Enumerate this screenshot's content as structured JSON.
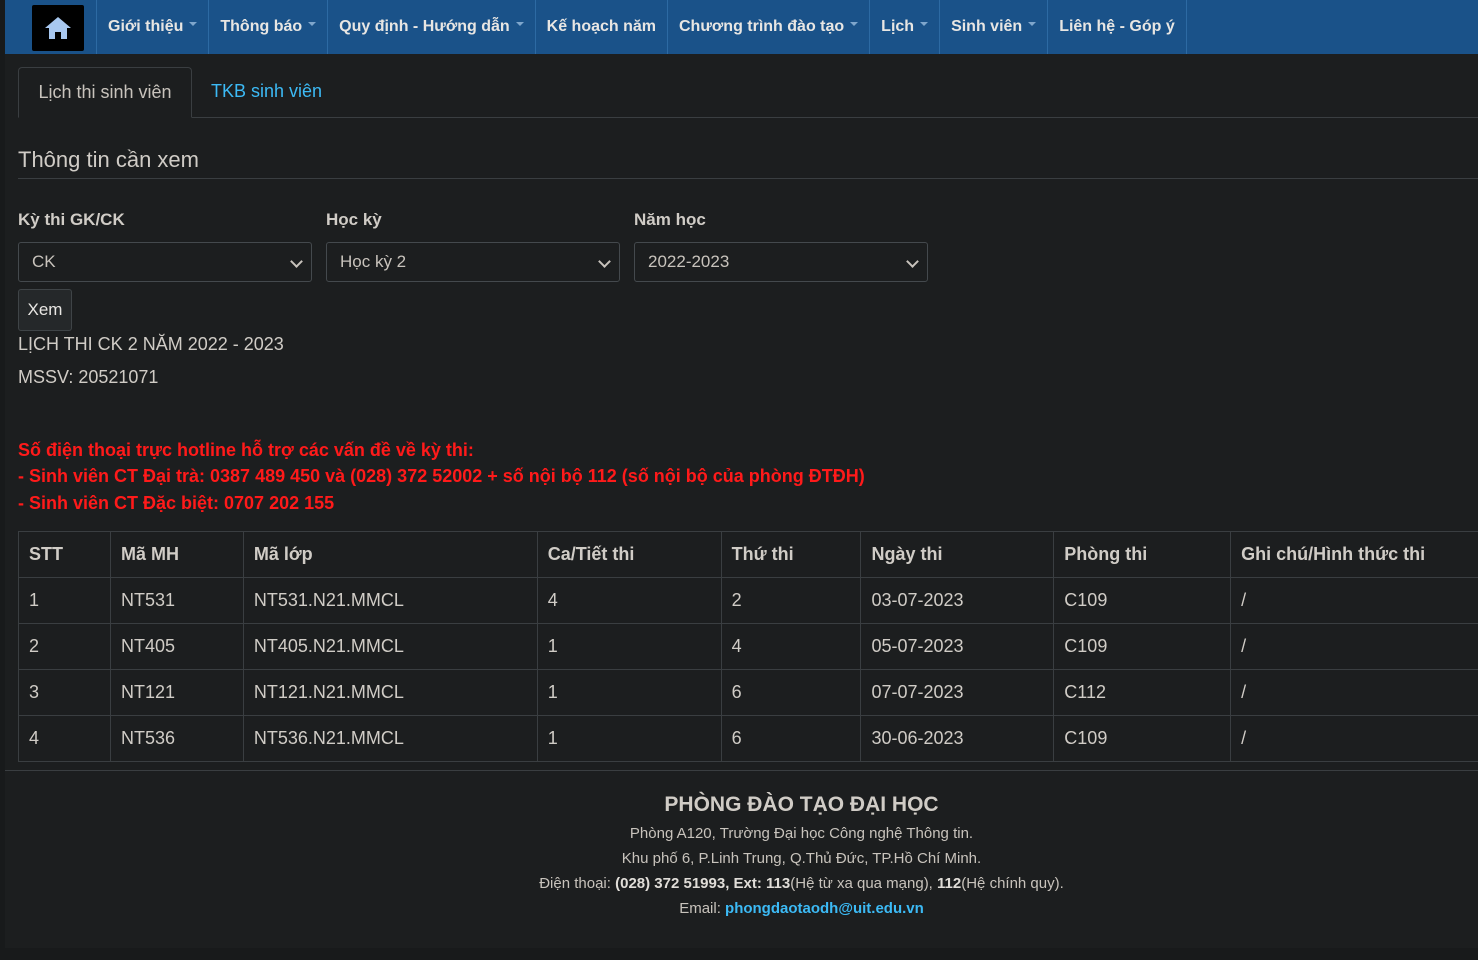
{
  "navbar": {
    "items": [
      {
        "label": "Giới thiệu",
        "dropdown": true
      },
      {
        "label": "Thông báo",
        "dropdown": true
      },
      {
        "label": "Quy định - Hướng dẫn",
        "dropdown": true
      },
      {
        "label": "Kế hoạch năm",
        "dropdown": false
      },
      {
        "label": "Chương trình đào tạo",
        "dropdown": true
      },
      {
        "label": "Lịch",
        "dropdown": true
      },
      {
        "label": "Sinh viên",
        "dropdown": true
      },
      {
        "label": "Liên hệ - Góp ý",
        "dropdown": false
      }
    ],
    "home_icon": "home-icon"
  },
  "tabs": {
    "active": "Lịch thi sinh viên",
    "other": "TKB sinh viên"
  },
  "form": {
    "section_title": "Thông tin cần xem",
    "exam_type": {
      "label": "Kỳ thi GK/CK",
      "value": "CK"
    },
    "semester": {
      "label": "Học kỳ",
      "value": "Học kỳ 2"
    },
    "year": {
      "label": "Năm học",
      "value": "2022-2023"
    },
    "submit_label": "Xem"
  },
  "result": {
    "heading": "LỊCH THI CK 2 NĂM 2022 - 2023",
    "student_id": "MSSV: 20521071"
  },
  "hotline": {
    "line1": "Số điện thoại trực hotline hỗ trợ các vấn đề về kỳ thi:",
    "line2": "- Sinh viên CT Đại trà: 0387 489 450 và (028) 372 52002 + số nội bộ 112 (số nội bộ của phòng ĐTĐH)",
    "line3": "- Sinh viên CT Đặc biệt: 0707 202 155",
    "color": "#ff1a1a"
  },
  "table": {
    "headers": [
      "STT",
      "Mã MH",
      "Mã lớp",
      "Ca/Tiết thi",
      "Thứ thi",
      "Ngày thi",
      "Phòng thi",
      "Ghi chú/Hình thức thi"
    ],
    "rows": [
      [
        "1",
        "NT531",
        "NT531.N21.MMCL",
        "4",
        "2",
        "03-07-2023",
        "C109",
        "/"
      ],
      [
        "2",
        "NT405",
        "NT405.N21.MMCL",
        "1",
        "4",
        "05-07-2023",
        "C109",
        "/"
      ],
      [
        "3",
        "NT121",
        "NT121.N21.MMCL",
        "1",
        "6",
        "07-07-2023",
        "C112",
        "/"
      ],
      [
        "4",
        "NT536",
        "NT536.N21.MMCL",
        "1",
        "6",
        "30-06-2023",
        "C109",
        "/"
      ]
    ]
  },
  "footer": {
    "title": "PHÒNG ĐÀO TẠO ĐẠI HỌC",
    "address1": "Phòng A120, Trường Đại học Công nghệ Thông tin.",
    "address2": "Khu phố 6, P.Linh Trung, Q.Thủ Đức, TP.Hồ Chí Minh.",
    "phone_prefix": "Điện thoại: ",
    "phone_bold": "(028) 372 51993, Ext: 113",
    "phone_mid": "(Hệ từ xa qua mạng), ",
    "phone_bold2": "112",
    "phone_suffix": "(Hệ chính quy).",
    "email_label": "Email: ",
    "email": "phongdaotaodh@uit.edu.vn"
  },
  "colors": {
    "navbar": "#1a5289",
    "link": "#3cbaf5",
    "background": "#1c1e1f"
  }
}
